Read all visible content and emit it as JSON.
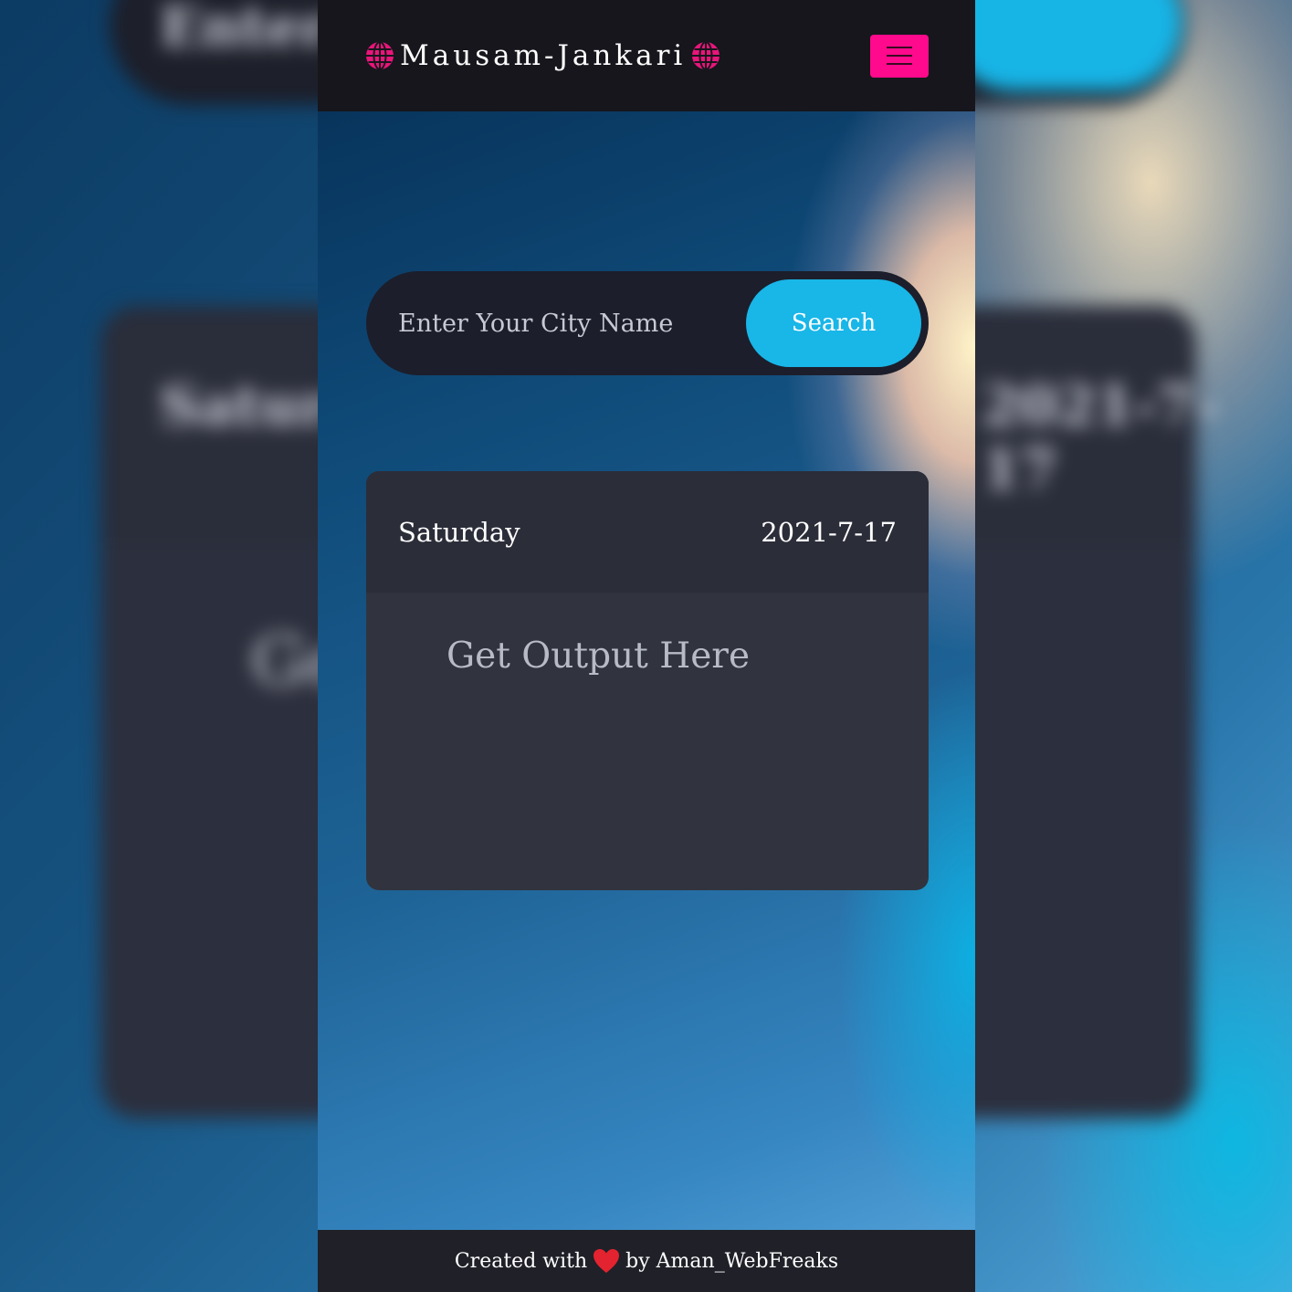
{
  "app": {
    "brand": "Mausam-Jankari",
    "left_icon": "globe-icon",
    "right_icon": "globe-icon",
    "menu_icon": "hamburger-icon"
  },
  "search": {
    "placeholder": "Enter Your City Name",
    "value": "",
    "button_label": "Search"
  },
  "card": {
    "day": "Saturday",
    "date": "2021-7-17",
    "output": "Get Output Here"
  },
  "footer": {
    "prefix": "Created with",
    "icon": "heart-icon",
    "suffix": "by Aman_WebFreaks"
  },
  "colors": {
    "accent_pink": "#ff0a8c",
    "button_blue": "#19b6e8",
    "navbar": "#16161c",
    "card": "#31343f"
  }
}
